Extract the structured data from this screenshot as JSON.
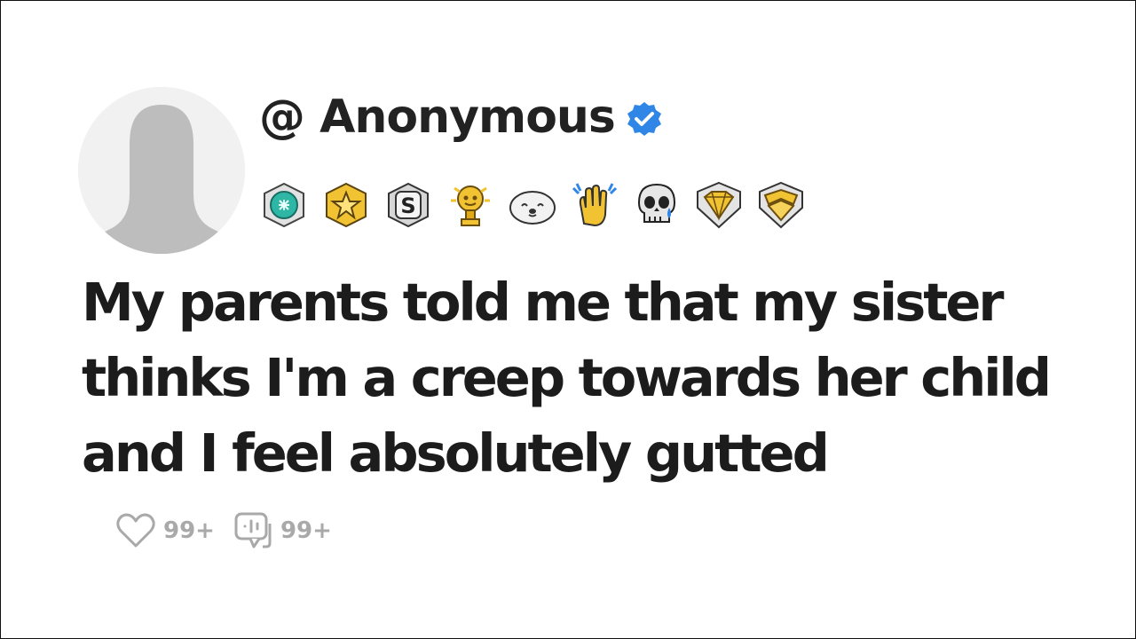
{
  "post": {
    "username": "@ Anonymous",
    "verified": true,
    "title": "My parents told me that my sister thinks I'm a creep towards her child and I feel absolutely gutted",
    "likes": "99+",
    "comments": "99+"
  },
  "badges": [
    {
      "icon": "teal-award-icon"
    },
    {
      "icon": "gold-star-award-icon"
    },
    {
      "icon": "silver-s-award-icon"
    },
    {
      "icon": "gold-trophy-award-icon"
    },
    {
      "icon": "seal-face-award-icon"
    },
    {
      "icon": "clapping-hands-award-icon"
    },
    {
      "icon": "crying-skull-award-icon"
    },
    {
      "icon": "gold-diamond-award-icon"
    },
    {
      "icon": "gold-chevron-award-icon"
    }
  ],
  "colors": {
    "verified": "#2f86e6",
    "text": "#1c1c1c",
    "muted": "#a9a9a9",
    "avatar": "#bdbdbd",
    "gold": "#f1c232",
    "teal": "#2fb7a5"
  }
}
